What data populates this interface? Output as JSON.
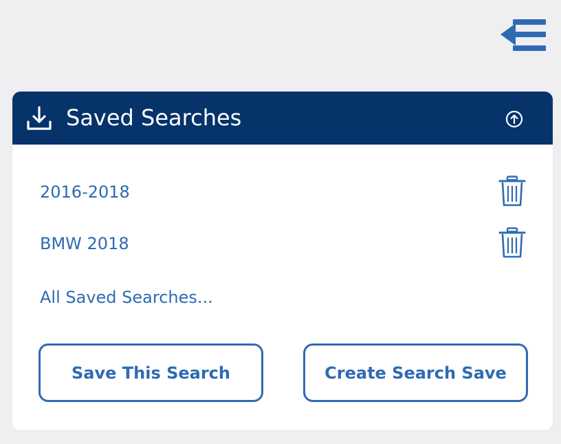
{
  "panel": {
    "title": "Saved Searches",
    "header_icon": "download-icon",
    "toggle_icon": "arrow-up-circle-icon"
  },
  "top_bar": {
    "collapse_icon": "arrow-left-menu-icon"
  },
  "saved_searches": [
    {
      "label": "2016-2018",
      "delete_icon": "trash-icon"
    },
    {
      "label": "BMW 2018",
      "delete_icon": "trash-icon"
    }
  ],
  "all_link": "All Saved Searches...",
  "buttons": {
    "save": "Save This Search",
    "create": "Create Search Save"
  },
  "colors": {
    "header_bg": "#05336a",
    "accent": "#2f6ab3",
    "page_bg": "#efeff1"
  }
}
